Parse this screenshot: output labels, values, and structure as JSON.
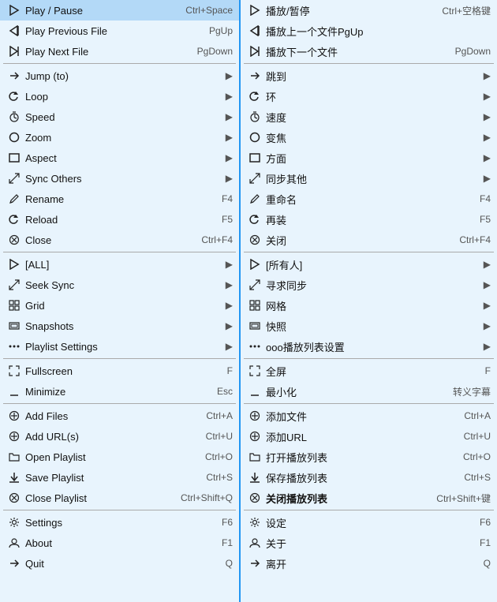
{
  "left": {
    "items": [
      {
        "id": "play-pause",
        "icon": "▷",
        "label": "Play / Pause",
        "shortcut": "Ctrl+Space",
        "arrow": "",
        "divider_after": false
      },
      {
        "id": "play-prev",
        "icon": "◁|",
        "label": "Play Previous File",
        "shortcut": "PgUp",
        "arrow": "",
        "divider_after": false
      },
      {
        "id": "play-next",
        "icon": "▷|",
        "label": "Play Next File",
        "shortcut": "PgDown",
        "arrow": "",
        "divider_after": true
      },
      {
        "id": "jump",
        "icon": "↩",
        "label": "Jump (to)",
        "shortcut": "",
        "arrow": "▶",
        "divider_after": false
      },
      {
        "id": "loop",
        "icon": "↺",
        "label": "Loop",
        "shortcut": "",
        "arrow": "▶",
        "divider_after": false
      },
      {
        "id": "speed",
        "icon": "⏱",
        "label": "Speed",
        "shortcut": "",
        "arrow": "▶",
        "divider_after": false
      },
      {
        "id": "zoom",
        "icon": "○",
        "label": "Zoom",
        "shortcut": "",
        "arrow": "▶",
        "divider_after": false
      },
      {
        "id": "aspect",
        "icon": "□",
        "label": "Aspect",
        "shortcut": "",
        "arrow": "▶",
        "divider_after": false
      },
      {
        "id": "sync-others",
        "icon": "↗↙",
        "label": "Sync Others",
        "shortcut": "",
        "arrow": "▶",
        "divider_after": false
      },
      {
        "id": "rename",
        "icon": "✎",
        "label": "Rename",
        "shortcut": "F4",
        "arrow": "",
        "divider_after": false
      },
      {
        "id": "reload",
        "icon": "↺",
        "label": "Reload",
        "shortcut": "F5",
        "arrow": "",
        "divider_after": false
      },
      {
        "id": "close",
        "icon": "⊗",
        "label": "Close",
        "shortcut": "Ctrl+F4",
        "arrow": "",
        "divider_after": true
      },
      {
        "id": "all",
        "icon": "▷",
        "label": "[ALL]",
        "shortcut": "",
        "arrow": "▶",
        "divider_after": false
      },
      {
        "id": "seek-sync",
        "icon": "↗↙",
        "label": "Seek Sync",
        "shortcut": "",
        "arrow": "▶",
        "divider_after": false
      },
      {
        "id": "grid",
        "icon": "⊞",
        "label": "Grid",
        "shortcut": "",
        "arrow": "▶",
        "divider_after": false
      },
      {
        "id": "snapshots",
        "icon": "◫",
        "label": "Snapshots",
        "shortcut": "",
        "arrow": "▶",
        "divider_after": false
      },
      {
        "id": "playlist-settings",
        "icon": "ooo",
        "label": "Playlist Settings",
        "shortcut": "",
        "arrow": "▶",
        "divider_after": true
      },
      {
        "id": "fullscreen",
        "icon": "⤢",
        "label": "Fullscreen",
        "shortcut": "F",
        "arrow": "",
        "divider_after": false
      },
      {
        "id": "minimize",
        "icon": "_",
        "label": "Minimize",
        "shortcut": "Esc",
        "arrow": "",
        "divider_after": true
      },
      {
        "id": "add-files",
        "icon": "⊕",
        "label": "Add Files",
        "shortcut": "Ctrl+A",
        "arrow": "",
        "divider_after": false
      },
      {
        "id": "add-urls",
        "icon": "⊕",
        "label": "Add URL(s)",
        "shortcut": "Ctrl+U",
        "arrow": "",
        "divider_after": false
      },
      {
        "id": "open-playlist",
        "icon": "📁",
        "label": "Open Playlist",
        "shortcut": "Ctrl+O",
        "arrow": "",
        "divider_after": false
      },
      {
        "id": "save-playlist",
        "icon": "⬇",
        "label": "Save Playlist",
        "shortcut": "Ctrl+S",
        "arrow": "",
        "divider_after": false
      },
      {
        "id": "close-playlist",
        "icon": "⊗",
        "label": "Close Playlist",
        "shortcut": "Ctrl+Shift+Q",
        "arrow": "",
        "divider_after": true
      },
      {
        "id": "settings",
        "icon": "⚙",
        "label": "Settings",
        "shortcut": "F6",
        "arrow": "",
        "divider_after": false
      },
      {
        "id": "about",
        "icon": "👤",
        "label": "About",
        "shortcut": "F1",
        "arrow": "",
        "divider_after": false
      },
      {
        "id": "quit",
        "icon": "↩",
        "label": "Quit",
        "shortcut": "Q",
        "arrow": "",
        "divider_after": false
      }
    ]
  },
  "right": {
    "items": [
      {
        "id": "r-play-pause",
        "icon": "▷",
        "label": "播放/暂停",
        "shortcut": "Ctrl+空格键",
        "arrow": "",
        "divider_after": false
      },
      {
        "id": "r-play-prev",
        "icon": "◁|",
        "label": "播放上一个文件PgUp",
        "shortcut": "",
        "arrow": "",
        "divider_after": false
      },
      {
        "id": "r-play-next",
        "icon": "▷|",
        "label": "播放下一个文件",
        "shortcut": "PgDown",
        "arrow": "",
        "divider_after": true
      },
      {
        "id": "r-jump",
        "icon": "↩",
        "label": "跳到",
        "shortcut": "",
        "arrow": "▶",
        "divider_after": false
      },
      {
        "id": "r-loop",
        "icon": "↺",
        "label": "环",
        "shortcut": "",
        "arrow": "▶",
        "divider_after": false
      },
      {
        "id": "r-speed",
        "icon": "⏱",
        "label": "速度",
        "shortcut": "",
        "arrow": "▶",
        "divider_after": false
      },
      {
        "id": "r-zoom",
        "icon": "○",
        "label": "变焦",
        "shortcut": "",
        "arrow": "▶",
        "divider_after": false
      },
      {
        "id": "r-aspect",
        "icon": "□",
        "label": "方面",
        "shortcut": "",
        "arrow": "▶",
        "divider_after": false
      },
      {
        "id": "r-sync-others",
        "icon": "↗↙",
        "label": "同步其他",
        "shortcut": "",
        "arrow": "▶",
        "divider_after": false
      },
      {
        "id": "r-rename",
        "icon": "✎",
        "label": "重命名",
        "shortcut": "F4",
        "arrow": "",
        "divider_after": false
      },
      {
        "id": "r-reload",
        "icon": "↺",
        "label": "再装",
        "shortcut": "F5",
        "arrow": "",
        "divider_after": false
      },
      {
        "id": "r-close",
        "icon": "⊗",
        "label": "关闭",
        "shortcut": "Ctrl+F4",
        "arrow": "",
        "divider_after": true
      },
      {
        "id": "r-all",
        "icon": "▷",
        "label": "[所有人]",
        "shortcut": "",
        "arrow": "▶",
        "divider_after": false
      },
      {
        "id": "r-seek-sync",
        "icon": "↗↙",
        "label": "寻求同步",
        "shortcut": "",
        "arrow": "▶",
        "divider_after": false
      },
      {
        "id": "r-grid",
        "icon": "⊞",
        "label": "网格",
        "shortcut": "",
        "arrow": "▶",
        "divider_after": false
      },
      {
        "id": "r-snapshots",
        "icon": "◫",
        "label": "快照",
        "shortcut": "",
        "arrow": "▶",
        "divider_after": false
      },
      {
        "id": "r-playlist-settings",
        "icon": "ooo",
        "label": "ooo播放列表设置",
        "shortcut": "",
        "arrow": "▶",
        "divider_after": true
      },
      {
        "id": "r-fullscreen",
        "icon": "⤢",
        "label": "全屏",
        "shortcut": "F",
        "arrow": "",
        "divider_after": false
      },
      {
        "id": "r-minimize",
        "icon": "_",
        "label": "最小化",
        "shortcut": "转义字幕",
        "arrow": "",
        "divider_after": true
      },
      {
        "id": "r-add-files",
        "icon": "⊕",
        "label": "添加文件",
        "shortcut": "Ctrl+A",
        "arrow": "",
        "divider_after": false
      },
      {
        "id": "r-add-urls",
        "icon": "⊕",
        "label": "添加URL",
        "shortcut": "Ctrl+U",
        "arrow": "",
        "divider_after": false
      },
      {
        "id": "r-open-playlist",
        "icon": "📁",
        "label": "打开播放列表",
        "shortcut": "Ctrl+O",
        "arrow": "",
        "divider_after": false
      },
      {
        "id": "r-save-playlist",
        "icon": "⬇",
        "label": "保存播放列表",
        "shortcut": "Ctrl+S",
        "arrow": "",
        "divider_after": false
      },
      {
        "id": "r-close-playlist",
        "icon": "⊗",
        "label": "关闭播放列表",
        "shortcut": "Ctrl+Shift+键",
        "arrow": "",
        "bold": true,
        "divider_after": true
      },
      {
        "id": "r-settings",
        "icon": "⚙",
        "label": "设定",
        "shortcut": "F6",
        "arrow": "",
        "divider_after": false
      },
      {
        "id": "r-about",
        "icon": "👤",
        "label": "关于",
        "shortcut": "F1",
        "arrow": "",
        "divider_after": false
      },
      {
        "id": "r-quit",
        "icon": "↩",
        "label": "离开",
        "shortcut": "Q",
        "arrow": "",
        "divider_after": false
      }
    ]
  }
}
